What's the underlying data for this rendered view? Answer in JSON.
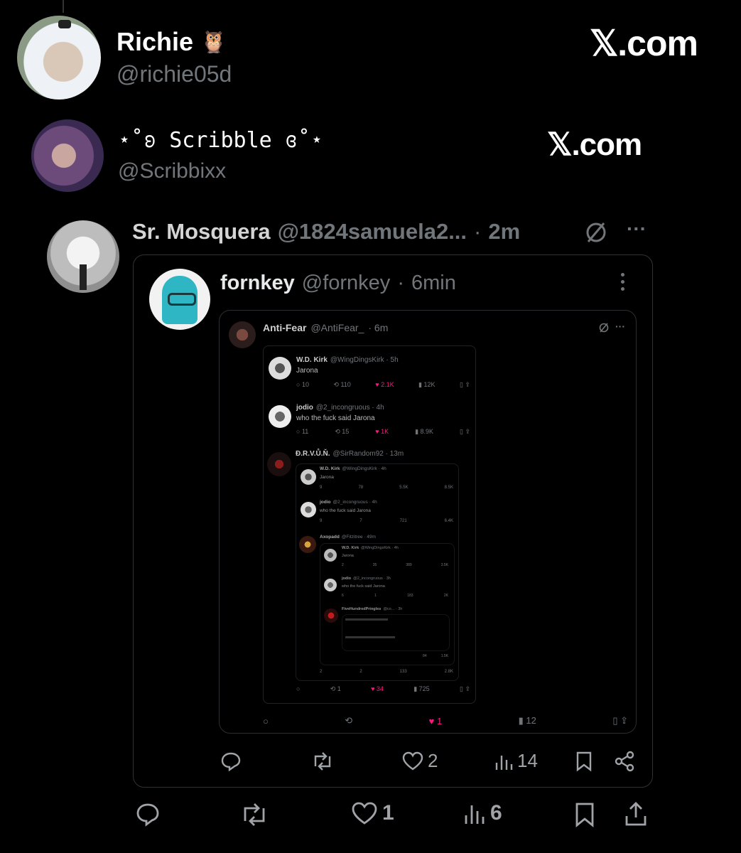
{
  "richie": {
    "name": "Richie",
    "emoji": "🦉",
    "handle": "@richie05d",
    "brand": "𝕏.com"
  },
  "scribble": {
    "name": "⋆˚ʚ Scribble ɞ˚⋆",
    "handle": "@Scribbixx",
    "brand": "𝕏.com"
  },
  "post": {
    "name": "Sr. Mosquera",
    "handle": "@1824samuela2...",
    "sep": "·",
    "time": "2m",
    "more": "···",
    "stats": {
      "likes": "1",
      "views": "6"
    }
  },
  "quote": {
    "name": "fornkey",
    "handle": "@fornkey",
    "sep": "·",
    "time": "6min",
    "stats": {
      "likes": "2",
      "views": "14"
    }
  },
  "antifear": {
    "name": "Anti-Fear",
    "handle": "@AntiFear_",
    "time": "· 6m",
    "more": "···",
    "stats": {
      "likes": "1",
      "views": "12"
    }
  },
  "inner": {
    "kirk": {
      "name": "W.D. Kirk",
      "handle": "@WingDingsKirk · 5h",
      "text": "Jarona",
      "replies": "10",
      "reposts": "110",
      "likes": "2.1K",
      "views": "12K"
    },
    "jodio": {
      "name": "jodio",
      "handle": "@2_incongruous · 4h",
      "text": "who the fuck said Jarona",
      "replies": "11",
      "reposts": "15",
      "likes": "1K",
      "views": "8.9K"
    },
    "drvun": {
      "name": "Đ.R.V.Ů.Ň.",
      "handle": "@SirRandom92 · 13m",
      "reposts": "1",
      "likes": "34",
      "views": "725"
    },
    "kirk2": {
      "name": "W.D. Kirk",
      "handle": "@WingDingsKirk · 4h",
      "text": "Jarona",
      "replies": "9",
      "reposts": "78",
      "likes": "5.5K",
      "views": "8.5K"
    },
    "jodio2": {
      "name": "jodio",
      "handle": "@2_incongruous · 4h",
      "text": "who the fuck said Jarona",
      "replies": "9",
      "reposts": "7",
      "likes": "721",
      "views": "6.4K"
    },
    "axopadd": {
      "name": "Axopadd",
      "handle": "@Fitzitree · 49m",
      "replies": "2",
      "reposts": "2",
      "likes": "133",
      "views": "2.8K"
    },
    "kirk3": {
      "name": "W.D. Kirk",
      "handle": "@WingDingsKirk · 4h",
      "text": "Jarona",
      "replies": "2",
      "reposts": "35",
      "likes": "389",
      "views": "3.5K"
    },
    "jodio3": {
      "name": "jodio",
      "handle": "@2_incongruous · 3h",
      "text": "who the fuck said Jarona",
      "replies": "6",
      "reposts": "1",
      "likes": "183",
      "views": "2K"
    },
    "pringles": {
      "name": "FiveHundredPringles",
      "handle": "@co... · 3h",
      "likes": "84",
      "views": "1.5K"
    }
  },
  "colors": {
    "like_pink": "#f91880",
    "muted": "#71767b",
    "text": "#e7e9ea",
    "border": "#2f3336"
  }
}
